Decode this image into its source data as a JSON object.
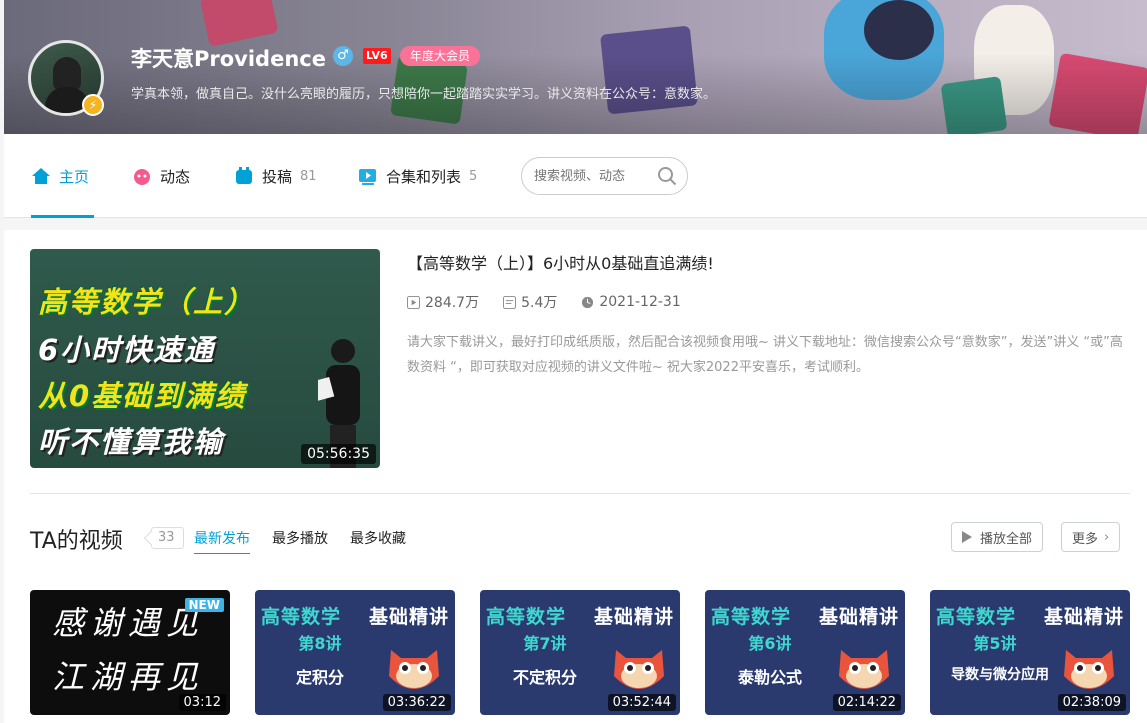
{
  "profile": {
    "name": "李天意Providence",
    "gender_symbol": "♂",
    "level": "LV6",
    "vip": "年度大会员",
    "bio": "学真本领，做真自己。没什么亮眼的履历，只想陪你一起踏踏实实学习。讲义资料在公众号：意数家。"
  },
  "nav": {
    "home": "主页",
    "dynamic": "动态",
    "posts": "投稿",
    "posts_count": "81",
    "collections": "合集和列表",
    "collections_count": "5",
    "search_placeholder": "搜索视频、动态"
  },
  "featured": {
    "title": "【高等数学（上）】6小时从0基础直追满绩!",
    "views": "284.7万",
    "danmaku": "5.4万",
    "date": "2021-12-31",
    "description": "请大家下载讲义，最好打印成纸质版，然后配合该视频食用哦~ 讲义下载地址：微信搜索公众号“意数家”，发送”讲义 “或”高数资料 “，即可获取对应视频的讲义文件啦~ 祝大家2022平安喜乐，考试顺利。",
    "duration": "05:56:35",
    "thumb_lines": [
      "高等数学（上）",
      "6小时快速通",
      "从0基础到满绩",
      "听不懂算我输"
    ]
  },
  "videos_section": {
    "title": "TA的视频",
    "count": "33",
    "sort_tabs": [
      "最新发布",
      "最多播放",
      "最多收藏"
    ],
    "play_all": "播放全部",
    "more": "更多"
  },
  "videos": [
    {
      "line1": "感谢遇见",
      "line2": "江湖再见",
      "badge": "NEW",
      "duration": "03:12"
    },
    {
      "header_left": "高等数学",
      "header_right": "基础精讲",
      "lecture": "第8讲",
      "topic": "定积分",
      "duration": "03:36:22"
    },
    {
      "header_left": "高等数学",
      "header_right": "基础精讲",
      "lecture": "第7讲",
      "topic": "不定积分",
      "duration": "03:52:44"
    },
    {
      "header_left": "高等数学",
      "header_right": "基础精讲",
      "lecture": "第6讲",
      "topic": "泰勒公式",
      "duration": "02:14:22"
    },
    {
      "header_left": "高等数学",
      "header_right": "基础精讲",
      "lecture": "第5讲",
      "topic": "导数与微分应用",
      "duration": "02:38:09"
    }
  ],
  "colors": {
    "accent": "#00a1d6",
    "vip_pink": "#fb7299",
    "level_red": "#ff1b1b",
    "thumb_yellow": "#f4e21b",
    "thumb_teal": "#3ed7d0"
  }
}
